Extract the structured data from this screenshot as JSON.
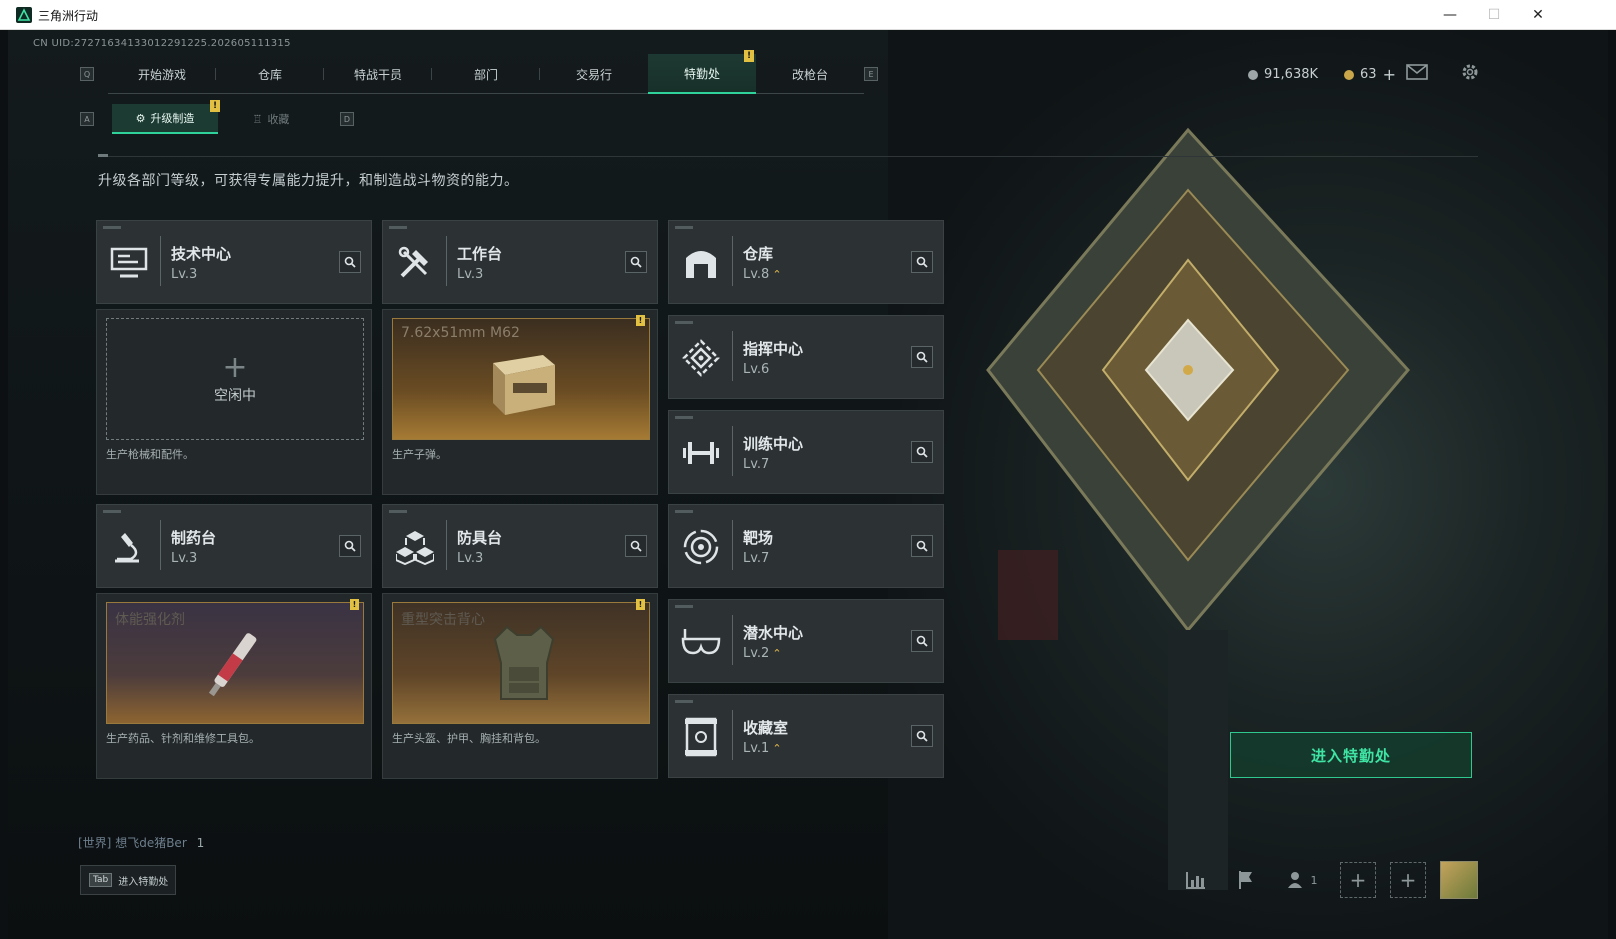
{
  "window": {
    "title": "三角洲行动",
    "min": "—",
    "max": "☐",
    "close": "✕"
  },
  "uid": "CN UID:27271634133012291225.202605111315",
  "nav": {
    "hint_left": "Q",
    "hint_right": "E",
    "tabs": [
      "开始游戏",
      "仓库",
      "特战干员",
      "部门",
      "交易行",
      "特勤处",
      "改枪台"
    ],
    "active_index": 5,
    "badge": "!"
  },
  "currency": {
    "coins": "91,638K",
    "tokens": "63",
    "add": "+"
  },
  "subnav": {
    "hint_left": "A",
    "hint_right": "D",
    "tabs": [
      "升级制造",
      "收藏"
    ],
    "badge": "!"
  },
  "description": "升级各部门等级，可获得专属能力提升，和制造战斗物资的能力。",
  "departments": {
    "tech": {
      "name": "技术中心",
      "level": "Lv.3",
      "icon": "monitor-icon"
    },
    "workbench": {
      "name": "工作台",
      "level": "Lv.3",
      "icon": "tools-icon"
    },
    "warehouse": {
      "name": "仓库",
      "level": "Lv.8",
      "icon": "warehouse-icon",
      "upgradable": true
    },
    "command": {
      "name": "指挥中心",
      "level": "Lv.6",
      "icon": "command-icon"
    },
    "training": {
      "name": "训练中心",
      "level": "Lv.7",
      "icon": "dumbbell-icon"
    },
    "pharmacy": {
      "name": "制药台",
      "level": "Lv.3",
      "icon": "microscope-icon"
    },
    "armor": {
      "name": "防具台",
      "level": "Lv.3",
      "icon": "cubes-icon"
    },
    "range": {
      "name": "靶场",
      "level": "Lv.7",
      "icon": "target-icon"
    },
    "diving": {
      "name": "潜水中心",
      "level": "Lv.2",
      "icon": "goggles-icon",
      "upgradable": true
    },
    "collection": {
      "name": "收藏室",
      "level": "Lv.1",
      "icon": "showcase-icon",
      "upgradable": true
    }
  },
  "upgrade_mark": "⌃",
  "production": {
    "tech": {
      "empty_label": "空闲中",
      "plus": "+",
      "desc": "生产枪械和配件。"
    },
    "workbench": {
      "item": "7.62x51mm M62",
      "desc": "生产子弹。",
      "badge": "!"
    },
    "pharmacy": {
      "item": "体能强化剂",
      "desc": "生产药品、针剂和维修工具包。",
      "badge": "!"
    },
    "armor": {
      "item": "重型突击背心",
      "desc": "生产头盔、护甲、胸挂和背包。",
      "badge": "!"
    }
  },
  "enter_button": "进入特勤处",
  "chat": {
    "channel": "[世界]",
    "user": "想飞de猪Ber",
    "count": "1"
  },
  "tab_hint": {
    "key": "Tab",
    "label": "进入特勤处"
  },
  "bottom": {
    "friends_count": "1",
    "add": "+"
  },
  "colors": {
    "accent": "#2fd29a",
    "badge": "#e2c042",
    "upgrade": "#e3b84a"
  }
}
